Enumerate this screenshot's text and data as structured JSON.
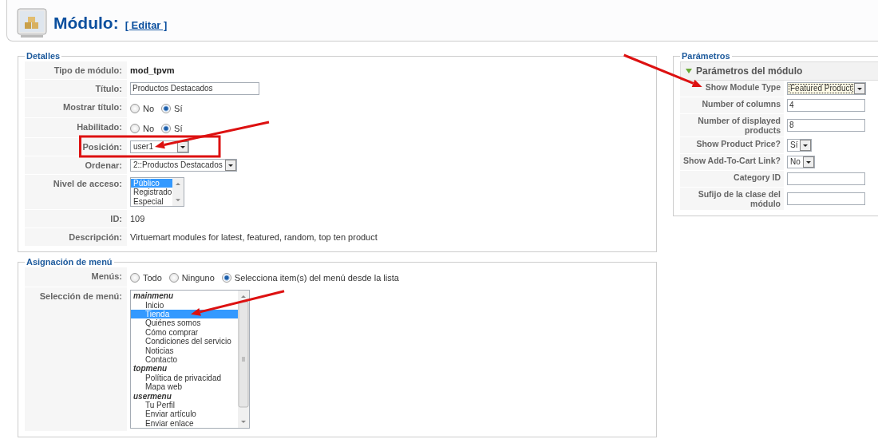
{
  "header": {
    "title": "Módulo:",
    "action": "[ Editar ]"
  },
  "details": {
    "legend": "Detalles",
    "rows": [
      {
        "label": "Tipo de módulo:",
        "kind": "text",
        "value": "mod_tpvm",
        "bold": true
      },
      {
        "label": "Título:",
        "kind": "input",
        "value": "Productos Destacados"
      },
      {
        "label": "Mostrar título:",
        "kind": "radio",
        "options": [
          {
            "label": "No",
            "selected": false
          },
          {
            "label": "Sí",
            "selected": true
          }
        ]
      },
      {
        "label": "Habilitado:",
        "kind": "radio",
        "options": [
          {
            "label": "No",
            "selected": false
          },
          {
            "label": "Sí",
            "selected": true
          }
        ]
      },
      {
        "label": "Posición:",
        "kind": "select",
        "value": "user1",
        "boxed": true,
        "arrow": true
      },
      {
        "label": "Ordenar:",
        "kind": "select",
        "value": "2::Productos Destacados"
      },
      {
        "label": "Nivel de acceso:",
        "kind": "listbox",
        "items": [
          {
            "label": "Público",
            "kind": "item",
            "selected": true
          },
          {
            "label": "Registrado",
            "kind": "item",
            "selected": false
          },
          {
            "label": "Especial",
            "kind": "item",
            "selected": false
          }
        ]
      },
      {
        "label": "ID:",
        "kind": "text",
        "value": "109"
      },
      {
        "label": "Descripción:",
        "kind": "text",
        "value": "Virtuemart modules for latest, featured, random, top ten product"
      }
    ]
  },
  "menu_assignment": {
    "legend": "Asignación de menú",
    "rows": [
      {
        "label": "Menús:",
        "kind": "radio",
        "options": [
          {
            "label": "Todo",
            "selected": false
          },
          {
            "label": "Ninguno",
            "selected": false
          },
          {
            "label": "Selecciona item(s) del menú desde la lista",
            "selected": true
          }
        ]
      },
      {
        "label": "Selección de menú:",
        "kind": "listbox",
        "items": [
          {
            "label": "mainmenu",
            "kind": "group",
            "children": [
              {
                "label": "Inicio",
                "kind": "item",
                "selected": false
              },
              {
                "label": "Tienda",
                "kind": "item",
                "selected": true,
                "arrow": true
              },
              {
                "label": "Quiénes somos",
                "kind": "item",
                "selected": false
              },
              {
                "label": "Cómo comprar",
                "kind": "item",
                "selected": false
              },
              {
                "label": "Condiciones del servicio",
                "kind": "item",
                "selected": false
              },
              {
                "label": "Noticias",
                "kind": "item",
                "selected": false
              },
              {
                "label": "Contacto",
                "kind": "item",
                "selected": false
              }
            ]
          },
          {
            "label": "topmenu",
            "kind": "group",
            "children": [
              {
                "label": "Política de privacidad",
                "kind": "item",
                "selected": false
              },
              {
                "label": "Mapa web",
                "kind": "item",
                "selected": false
              }
            ]
          },
          {
            "label": "usermenu",
            "kind": "group",
            "children": [
              {
                "label": "Tu Perfil",
                "kind": "item",
                "selected": false
              },
              {
                "label": "Enviar artículo",
                "kind": "item",
                "selected": false
              },
              {
                "label": "Enviar enlace",
                "kind": "item",
                "selected": false
              }
            ]
          }
        ]
      }
    ]
  },
  "parameters": {
    "legend": "Parámetros",
    "section": {
      "title": "Parámetros del módulo",
      "expanded": true
    },
    "rows": [
      {
        "label": "Show Module Type",
        "kind": "select",
        "value": "Featured Product",
        "focused": true,
        "arrow": true
      },
      {
        "label": "Number of columns",
        "kind": "input",
        "value": "4"
      },
      {
        "label": "Number of displayed products",
        "kind": "input",
        "value": "8"
      },
      {
        "label": "Show Product Price?",
        "kind": "select",
        "value": "Sí"
      },
      {
        "label": "Show Add-To-Cart Link?",
        "kind": "select",
        "value": "No"
      },
      {
        "label": "Category ID",
        "kind": "input"
      },
      {
        "label": "Sufijo de la clase del módulo",
        "kind": "input"
      }
    ]
  }
}
